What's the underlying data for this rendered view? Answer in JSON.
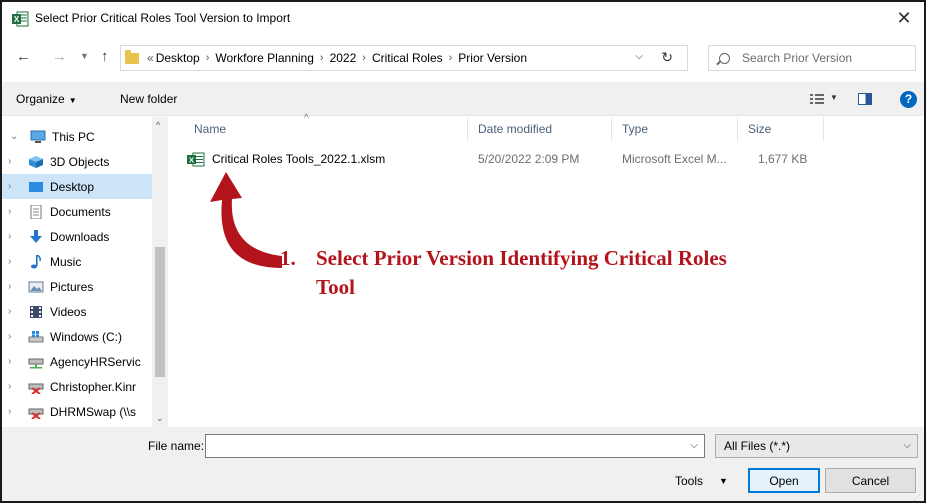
{
  "window": {
    "title": "Select Prior Critical Roles Tool Version to Import",
    "close_glyph": "✕"
  },
  "colors": {
    "accent": "#0078d7",
    "selection": "#cce4f7",
    "annotation": "#b3141c",
    "excel_green": "#1d6f42",
    "header_text": "#4c607a"
  },
  "navigation": {
    "back_icon": "back-arrow-icon",
    "forward_icon": "forward-arrow-icon",
    "up_icon": "up-arrow-icon"
  },
  "address": {
    "lead": "«",
    "crumbs": [
      "Desktop",
      "Workfore Planning",
      "2022",
      "Critical Roles",
      "Prior Version"
    ]
  },
  "search": {
    "placeholder": "Search Prior Version"
  },
  "toolbar": {
    "organize_label": "Organize",
    "new_folder_label": "New folder",
    "help_label": "?"
  },
  "sidebar": {
    "items": [
      {
        "label": "This PC",
        "icon": "monitor-icon",
        "expanded": true
      },
      {
        "label": "3D Objects",
        "icon": "cube-icon"
      },
      {
        "label": "Desktop",
        "icon": "desktop-icon",
        "selected": true
      },
      {
        "label": "Documents",
        "icon": "document-icon"
      },
      {
        "label": "Downloads",
        "icon": "download-icon"
      },
      {
        "label": "Music",
        "icon": "music-note-icon"
      },
      {
        "label": "Pictures",
        "icon": "picture-icon"
      },
      {
        "label": "Videos",
        "icon": "video-icon"
      },
      {
        "label": "Windows (C:)",
        "icon": "drive-icon"
      },
      {
        "label": "AgencyHRServic",
        "icon": "network-drive-icon"
      },
      {
        "label": "Christopher.Kinr",
        "icon": "disconnected-drive-icon"
      },
      {
        "label": "DHRMSwap (\\\\s",
        "icon": "disconnected-drive-icon"
      }
    ]
  },
  "columns": {
    "name": "Name",
    "date": "Date modified",
    "type": "Type",
    "size": "Size"
  },
  "files": [
    {
      "name": "Critical Roles Tools_2022.1.xlsm",
      "date": "5/20/2022 2:09 PM",
      "type": "Microsoft Excel M...",
      "size": "1,677 KB"
    }
  ],
  "annotation": {
    "number": "1.",
    "line1": "Select Prior Version Identifying Critical Roles",
    "line2": "Tool"
  },
  "bottom": {
    "file_name_label": "File name:",
    "file_name_value": "",
    "filter_value": "All Files (*.*)",
    "tools_label": "Tools",
    "open_label": "Open",
    "cancel_label": "Cancel"
  }
}
